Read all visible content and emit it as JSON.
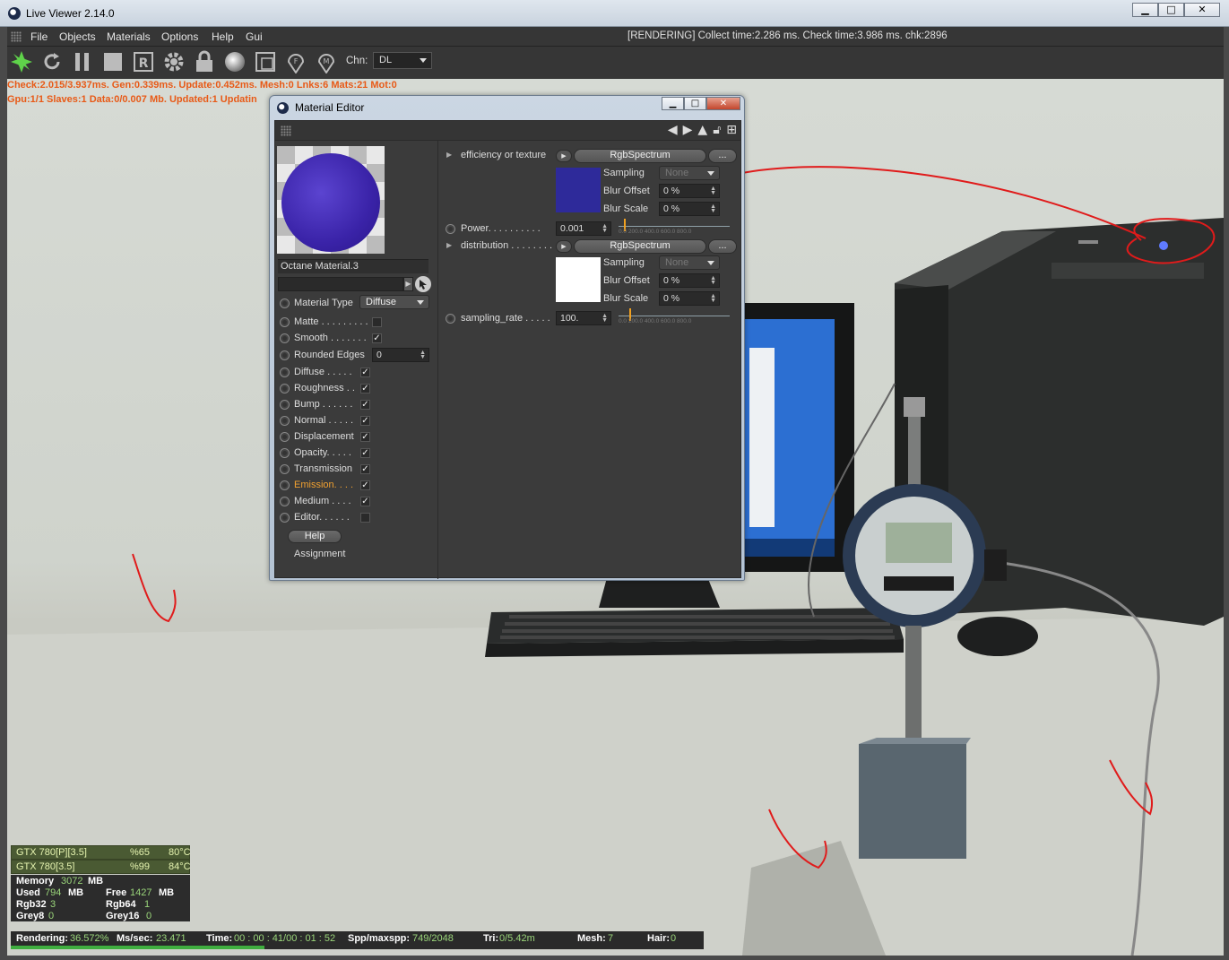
{
  "window": {
    "title": "Live Viewer 2.14.0",
    "btn_min": "▁",
    "btn_max": "□",
    "btn_close": "✕"
  },
  "menu": {
    "items": [
      "File",
      "Objects",
      "Materials",
      "Options",
      "Help",
      "Gui"
    ],
    "status": "[RENDERING] Collect time:2.286 ms.  Check time:3.986 ms.  chk:2896"
  },
  "toolbar": {
    "icons": [
      "octane-logo-icon",
      "refresh-icon",
      "pause-icon",
      "stop-icon",
      "render-r-icon",
      "gear-icon",
      "lock-icon",
      "sphere-icon",
      "region-icon",
      "focus-pin-icon",
      "material-pin-icon"
    ],
    "channel_label": "Chn:",
    "channel_value": "DL"
  },
  "info": {
    "line1": "Check:2.015/3.937ms. Gen:0.339ms. Update:0.452ms. Mesh:0 Lnks:6 Mats:21 Mot:0",
    "line2": "Gpu:1/1 Slaves:1  Data:0/0.007 Mb.   Updated:1 Updatin"
  },
  "material_editor": {
    "title": "Material Editor",
    "material_name": "Octane Material.3",
    "material_type_label": "Material Type",
    "material_type_value": "Diffuse",
    "channels": [
      {
        "label": "Matte . . . . . . . . .",
        "checked": false
      },
      {
        "label": "Smooth  . . . . . . .",
        "checked": true
      },
      {
        "label": "Rounded Edges",
        "value": "0"
      },
      {
        "label": "Diffuse . . . . .",
        "checked": true
      },
      {
        "label": "Roughness  . .",
        "checked": true
      },
      {
        "label": "Bump  . . . . . .",
        "checked": true
      },
      {
        "label": "Normal . . . . .",
        "checked": true
      },
      {
        "label": "Displacement",
        "checked": true
      },
      {
        "label": "Opacity. . . . .",
        "checked": true
      },
      {
        "label": "Transmission",
        "checked": true
      },
      {
        "label": "Emission. . . .",
        "checked": true,
        "active": true
      },
      {
        "label": "Medium . . . .",
        "checked": true
      },
      {
        "label": "Editor. . . . . .",
        "checked": false
      }
    ],
    "help_label": "Help",
    "assignment_label": "Assignment",
    "right": {
      "efficiency_label": "efficiency or texture",
      "efficiency_btn": "RgbSpectrum",
      "more_btn": "...",
      "sampling_label": "Sampling",
      "sampling_value": "None",
      "blur_offset_label": "Blur Offset",
      "blur_offset_value": "0 %",
      "blur_scale_label": "Blur Scale",
      "blur_scale_value": "0 %",
      "power_label": "Power. . . . . . . . . .",
      "power_value": "0.001",
      "distribution_label": "distribution . . . . . . . .",
      "distribution_btn": "RgbSpectrum",
      "sampling2_label": "Sampling",
      "sampling2_value": "None",
      "blur_offset2_label": "Blur Offset",
      "blur_offset2_value": "0 %",
      "blur_scale2_label": "Blur Scale",
      "blur_scale2_value": "0 %",
      "sampling_rate_label": "sampling_rate . . . . .",
      "sampling_rate_value": "100.",
      "slider_ticks": "0.0  200.0  400.0  600.0  800.0",
      "power_fraction": 0.001,
      "rate_fraction": 0.1
    },
    "swatch1_color": "#2e2a9a",
    "swatch2_color": "#ffffff"
  },
  "gpu": {
    "rows": [
      {
        "name": "GTX 780[P][3.5]",
        "load": "%65",
        "temp": "80°C"
      },
      {
        "name": "GTX 780[3.5]",
        "load": "%99",
        "temp": "84°C"
      }
    ],
    "memory_label": "Memory",
    "memory_value": "3072",
    "memory_unit": "MB",
    "used_label": "Used",
    "used_value": "794",
    "used_unit": "MB",
    "free_label": "Free",
    "free_value": "1427",
    "free_unit": "MB",
    "rgb32_label": "Rgb32",
    "rgb32_value": "3",
    "rgb64_label": "Rgb64",
    "rgb64_value": "1",
    "grey8_label": "Grey8",
    "grey8_value": "0",
    "grey16_label": "Grey16",
    "grey16_value": "0"
  },
  "status": {
    "rendering_label": "Rendering:",
    "rendering_value": "36.572%",
    "ms_label": "Ms/sec:",
    "ms_value": "23.471",
    "time_label": "Time:",
    "time_value": "00 : 00 : 41/00 : 01 : 52",
    "spp_label": "Spp/maxspp:",
    "spp_value": "749/2048",
    "tri_label": "Tri:",
    "tri_value": "0/5.42m",
    "mesh_label": "Mesh:",
    "mesh_value": "7",
    "hair_label": "Hair:",
    "hair_value": "0",
    "progress_fraction": 0.36572
  }
}
